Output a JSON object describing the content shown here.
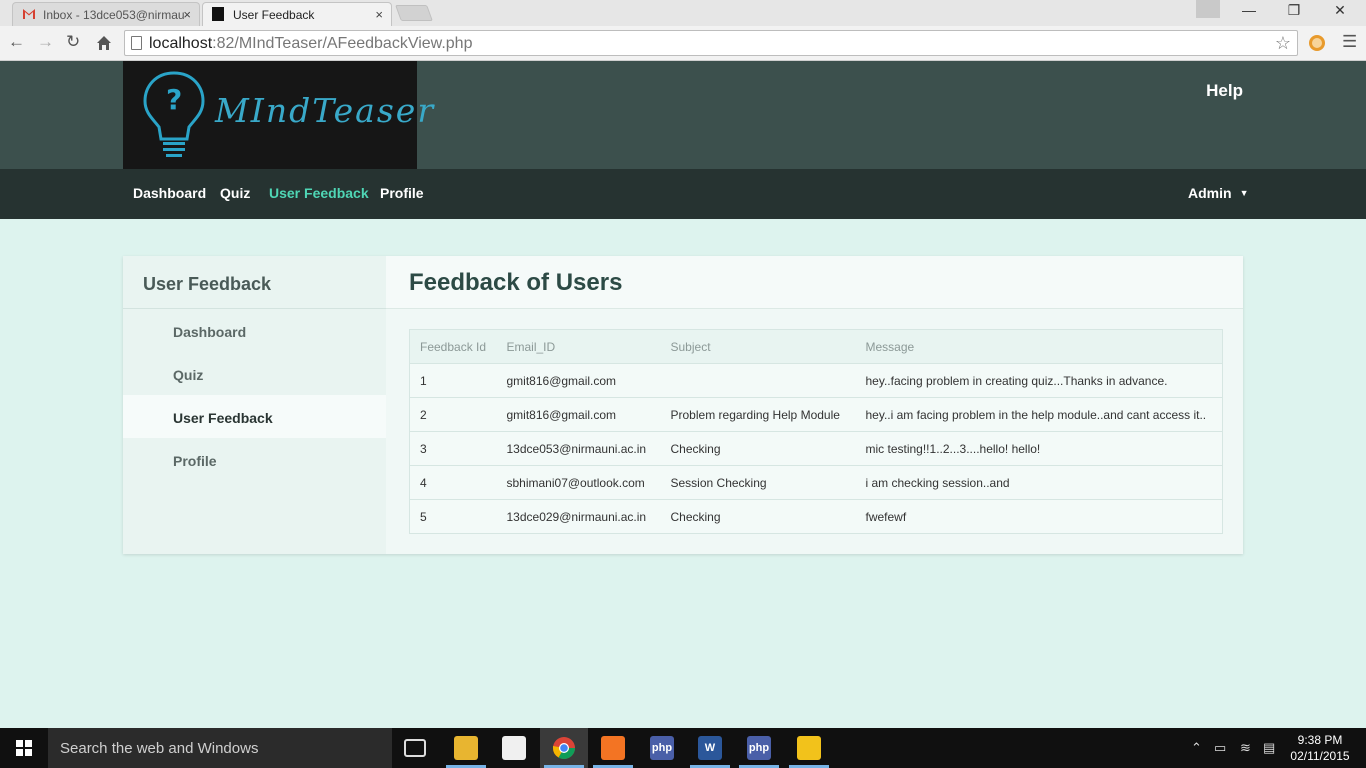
{
  "browser": {
    "tabs": [
      {
        "label": "Inbox - 13dce053@nirmau",
        "close": "×"
      },
      {
        "label": "User Feedback",
        "close": "×"
      }
    ],
    "url_host": "localhost",
    "url_path": ":82/MIndTeaser/AFeedbackView.php",
    "window_controls": {
      "minimize": "—",
      "restore": "❐",
      "close": "✕"
    }
  },
  "site": {
    "logo_text": "MIndTeaser",
    "help_label": "Help",
    "nav": [
      "Dashboard",
      "Quiz",
      "User Feedback",
      "Profile"
    ],
    "active_nav": "User Feedback",
    "admin_label": "Admin"
  },
  "sidebar": {
    "title": "User Feedback",
    "items": [
      "Dashboard",
      "Quiz",
      "User Feedback",
      "Profile"
    ],
    "active": "User Feedback"
  },
  "main": {
    "title": "Feedback of Users",
    "table": {
      "headers": [
        "Feedback Id",
        "Email_ID",
        "Subject",
        "Message"
      ],
      "rows": [
        [
          "1",
          "gmit816@gmail.com",
          "",
          "hey..facing problem in creating quiz...Thanks in advance."
        ],
        [
          "2",
          "gmit816@gmail.com",
          "Problem regarding Help Module",
          "hey..i am facing problem in the help module..and cant access it.."
        ],
        [
          "3",
          "13dce053@nirmauni.ac.in",
          "Checking",
          "mic testing!!1..2...3....hello! hello!"
        ],
        [
          "4",
          "sbhimani07@outlook.com",
          "Session Checking",
          "i am checking session..and"
        ],
        [
          "5",
          "13dce029@nirmauni.ac.in",
          "Checking",
          "fwefewf"
        ]
      ]
    }
  },
  "taskbar": {
    "search_placeholder": "Search the web and Windows",
    "time": "9:38 PM",
    "date": "02/11/2015"
  },
  "colors": {
    "header_bg": "#3c504d",
    "nav_bg": "#263331",
    "accent": "#4fd6b5",
    "page_bg": "#ddf3ee"
  }
}
